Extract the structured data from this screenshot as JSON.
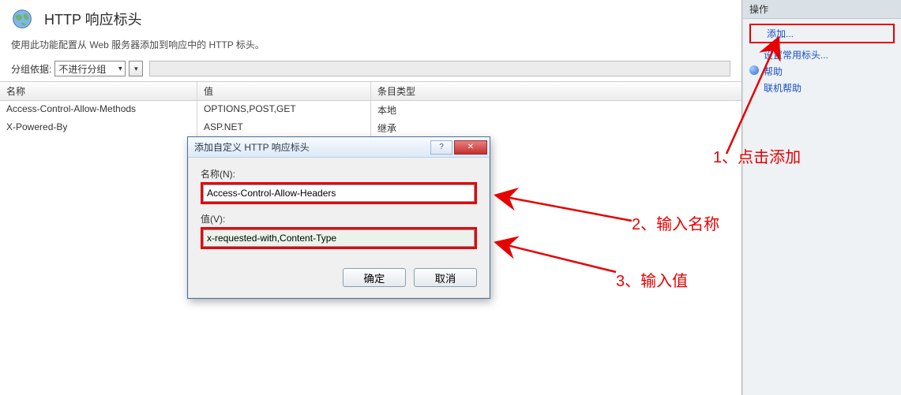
{
  "header": {
    "title": "HTTP 响应标头",
    "description": "使用此功能配置从 Web 服务器添加到响应中的 HTTP 标头。"
  },
  "grouping": {
    "label": "分组依据:",
    "value": "不进行分组"
  },
  "table": {
    "columns": {
      "name": "名称",
      "value": "值",
      "type": "条目类型"
    },
    "rows": [
      {
        "name": "Access-Control-Allow-Methods",
        "value": "OPTIONS,POST,GET",
        "type": "本地"
      },
      {
        "name": "X-Powered-By",
        "value": "ASP.NET",
        "type": "继承"
      }
    ]
  },
  "sidebar": {
    "title": "操作",
    "add": "添加...",
    "setCommon": "设置常用标头...",
    "help": "帮助",
    "onlineHelp": "联机帮助"
  },
  "dialog": {
    "title": "添加自定义 HTTP 响应标头",
    "nameLabel": "名称(N):",
    "nameValue": "Access-Control-Allow-Headers",
    "valueLabel": "值(V):",
    "valueValue": "x-requested-with,Content-Type",
    "ok": "确定",
    "cancel": "取消"
  },
  "annotations": {
    "step1": "1、点击添加",
    "step2": "2、输入名称",
    "step3": "3、输入值"
  }
}
